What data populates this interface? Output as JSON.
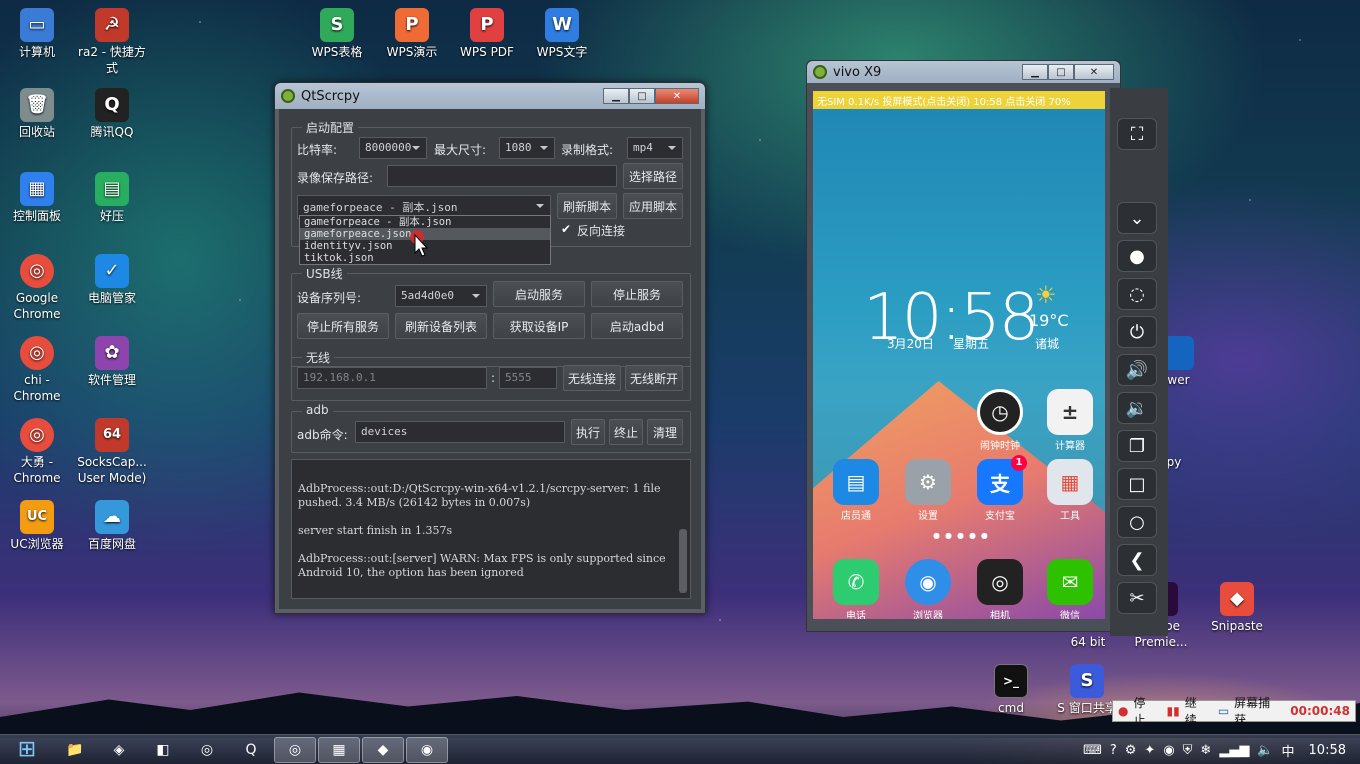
{
  "desktop": {
    "icons": [
      {
        "label": "计算机",
        "color": "#3a7bd5",
        "glyph": "▭"
      },
      {
        "label": "ra2 - 快捷方式",
        "color": "#c0392b",
        "glyph": "☭"
      },
      {
        "label": "回收站",
        "color": "#7f8c8d",
        "glyph": "🗑"
      },
      {
        "label": "腾讯QQ",
        "color": "#222",
        "glyph": "Q"
      },
      {
        "label": "控制面板",
        "color": "#2f80ed",
        "glyph": "▦"
      },
      {
        "label": "好压",
        "color": "#27ae60",
        "glyph": "▤"
      },
      {
        "label": "Google Chrome",
        "color": "#e74c3c",
        "glyph": "◎"
      },
      {
        "label": "电脑管家",
        "color": "#1e88e5",
        "glyph": "✓"
      },
      {
        "label": "chi - Chrome",
        "color": "#e74c3c",
        "glyph": "◎"
      },
      {
        "label": "软件管理",
        "color": "#8e44ad",
        "glyph": "✿"
      },
      {
        "label": "大勇 - Chrome",
        "color": "#e74c3c",
        "glyph": "◎"
      },
      {
        "label": "SocksCap... User Mode)",
        "color": "#c0392b",
        "glyph": "64"
      },
      {
        "label": "UC浏览器",
        "color": "#f39c12",
        "glyph": "UC"
      },
      {
        "label": "百度网盘",
        "color": "#3498db",
        "glyph": "☁"
      },
      {
        "label": "WPS表格",
        "color": "#2eaa5a",
        "glyph": "S"
      },
      {
        "label": "WPS演示",
        "color": "#f06a35",
        "glyph": "P"
      },
      {
        "label": "WPS PDF",
        "color": "#e04040",
        "glyph": "P"
      },
      {
        "label": "WPS文字",
        "color": "#2f7de1",
        "glyph": "W"
      },
      {
        "label": "ewer",
        "color": "#1565c0",
        "glyph": ""
      },
      {
        "label": "cpy",
        "color": "#7db23a",
        "glyph": ""
      },
      {
        "label": "64 bit",
        "color": "transparent",
        "glyph": ""
      },
      {
        "label": "Adobe Premie...",
        "color": "#2a0a3a",
        "glyph": ""
      },
      {
        "label": "Snipaste",
        "color": "#e84c3d",
        "glyph": "◆"
      },
      {
        "label": "cmd",
        "color": "#111",
        "glyph": ">_"
      },
      {
        "label": "S 窗口共享",
        "color": "#3b5bdb",
        "glyph": "S"
      }
    ]
  },
  "qtscrcpy": {
    "title": "QtScrcpy",
    "win_min": "▁",
    "win_max": "□",
    "win_close": "✕",
    "startup": {
      "group_title": "启动配置",
      "bitrate_label": "比特率:",
      "bitrate_value": "8000000",
      "maxsize_label": "最大尺寸:",
      "maxsize_value": "1080",
      "format_label": "录制格式:",
      "format_value": "mp4",
      "savepath_label": "录像保存路径:",
      "savepath_value": "",
      "select_path": "选择路径",
      "script_value": "gameforpeace - 副本.json",
      "refresh_script": "刷新脚本",
      "apply_script": "应用脚本",
      "reverse_label": "反向连接",
      "reverse_check": "✔",
      "script_options": [
        "gameforpeace - 副本.json",
        "gameforpeace.json",
        "identityv.json",
        "tiktok.json"
      ]
    },
    "usb": {
      "group_title": "USB线",
      "serial_label": "设备序列号:",
      "serial_value": "5ad4d0e0",
      "start_service": "启动服务",
      "stop_service": "停止服务",
      "stop_all": "停止所有服务",
      "refresh_devices": "刷新设备列表",
      "get_ip": "获取设备IP",
      "start_adbd": "启动adbd"
    },
    "wireless": {
      "group_title": "无线",
      "ip_placeholder": "192.168.0.1",
      "colon": ":",
      "port_placeholder": "5555",
      "connect": "无线连接",
      "disconnect": "无线断开"
    },
    "adb": {
      "group_title": "adb",
      "cmd_label": "adb命令:",
      "cmd_value": "devices",
      "execute": "执行",
      "terminate": "终止",
      "clear": "清理"
    },
    "log": "AdbProcess::out:D:/QtScrcpy-win-x64-v1.2.1/scrcpy-server: 1 file pushed. 3.4 MB/s (26142 bytes in 0.007s)\n\nserver start finish in 1.357s\n\nAdbProcess::out:[server] WARN: Max FPS is only supported since Android 10, the option has been ignored"
  },
  "phone": {
    "title": "vivo X9",
    "status": "无SIM 0.1K/s  投屏模式(点击关闭)   10:58    点击关闭   70%",
    "time": "10:58",
    "date": "3月20日",
    "weekday": "星期五",
    "temp": "19°C",
    "city": "诸城",
    "apps": [
      {
        "label": "闹钟时钟",
        "color": "#222",
        "glyph": "◷"
      },
      {
        "label": "计算器",
        "color": "#f2f2f2",
        "glyph": "±"
      },
      {
        "label": "店员通",
        "color": "#1e88e5",
        "glyph": "▤"
      },
      {
        "label": "设置",
        "color": "#9aa1a8",
        "glyph": "⚙"
      },
      {
        "label": "支付宝",
        "color": "#1677ff",
        "glyph": "支"
      },
      {
        "label": "工具",
        "color": "#e0e6ec",
        "glyph": "▦"
      },
      {
        "label": "电话",
        "color": "#2ecc71",
        "glyph": "✆"
      },
      {
        "label": "浏览器",
        "color": "#2f8fe8",
        "glyph": "◉"
      },
      {
        "label": "相机",
        "color": "#222",
        "glyph": "◎"
      },
      {
        "label": "微信",
        "color": "#2dc100",
        "glyph": "✉"
      }
    ],
    "alipay_badge": "1"
  },
  "toolbar": {
    "fullscreen": "⛶",
    "expand": "⌄",
    "dot": "●",
    "eye": "◌",
    "power": "⏻",
    "vol_up": "🔊",
    "vol_down": "🔉",
    "switch": "❐",
    "home_square": "□",
    "home_circle": "○",
    "back": "❮",
    "cut": "✂"
  },
  "recorder": {
    "stop": "停止",
    "resume": "继续",
    "capture": "屏幕捕获",
    "elapsed": "00:00:48"
  },
  "taskbar": {
    "start": "⊞",
    "clock": "10:58",
    "items": [
      "📁",
      "◈",
      "◧",
      "◎",
      "Q",
      "◎",
      "▦",
      "◆",
      "◉"
    ]
  }
}
